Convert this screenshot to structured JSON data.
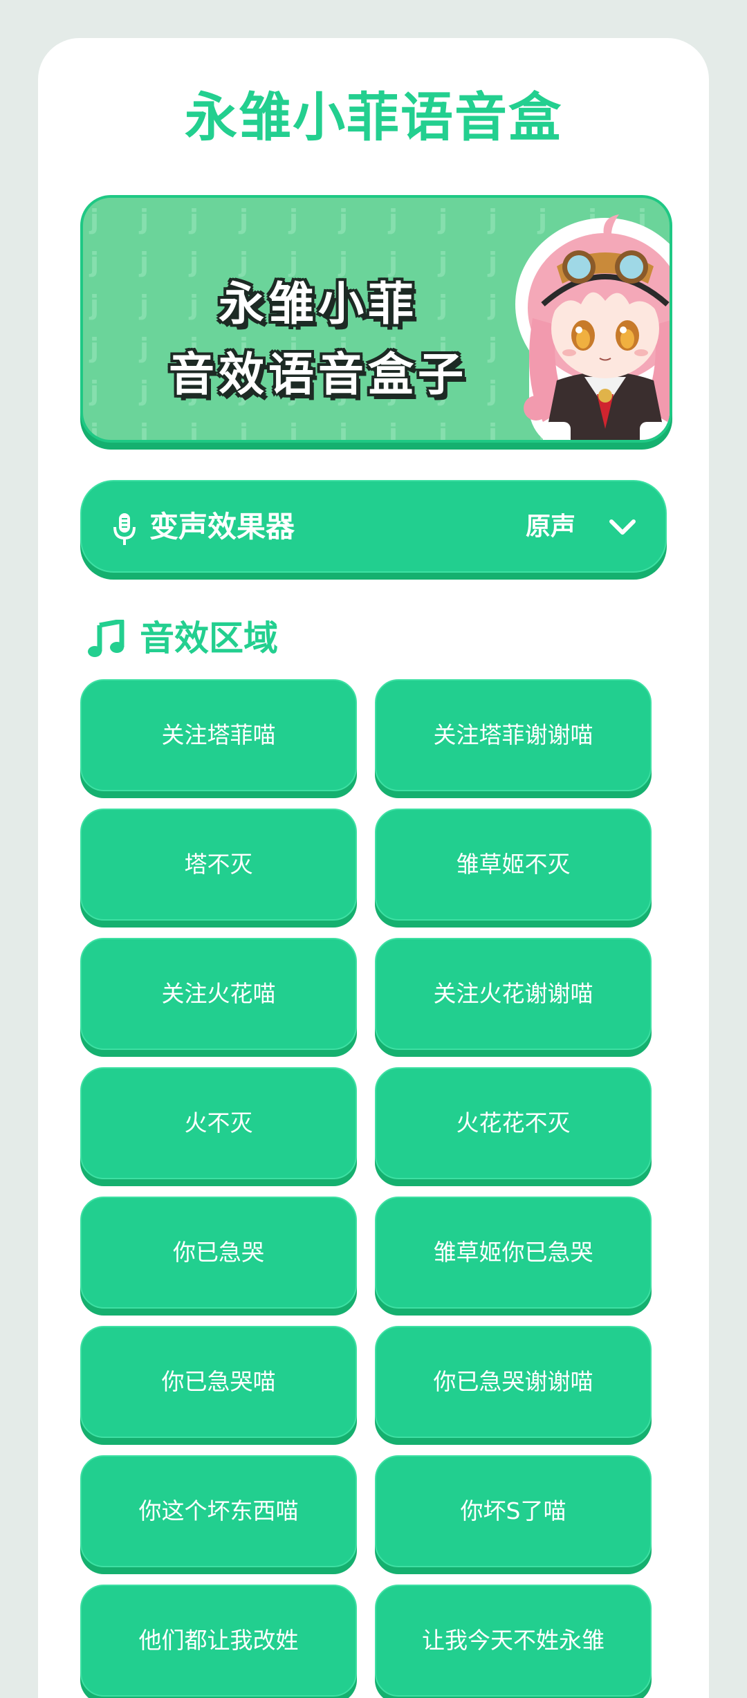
{
  "app": {
    "title": "永雏小菲语音盒"
  },
  "banner": {
    "line1": "永雏小菲",
    "line2": "音效语音盒子"
  },
  "voice_changer": {
    "label": "变声效果器",
    "value": "原声",
    "icon": "microphone-icon",
    "dropdown_icon": "chevron-down-icon"
  },
  "sound_section": {
    "title": "音效区域",
    "icon": "music-note-icon"
  },
  "sounds": [
    "关注塔菲喵",
    "关注塔菲谢谢喵",
    "塔不灭",
    "雏草姬不灭",
    "关注火花喵",
    "关注火花谢谢喵",
    "火不灭",
    "火花花不灭",
    "你已急哭",
    "雏草姬你已急哭",
    "你已急哭喵",
    "你已急哭谢谢喵",
    "你这个坏东西喵",
    "你坏S了喵",
    "他们都让我改姓",
    "让我今天不姓永雏"
  ],
  "colors": {
    "accent": "#23cf8f",
    "button": "#22cf8f",
    "button_shadow": "#15b06f",
    "banner_bg": "#6bd49a",
    "page_bg": "#e4ebe8"
  }
}
